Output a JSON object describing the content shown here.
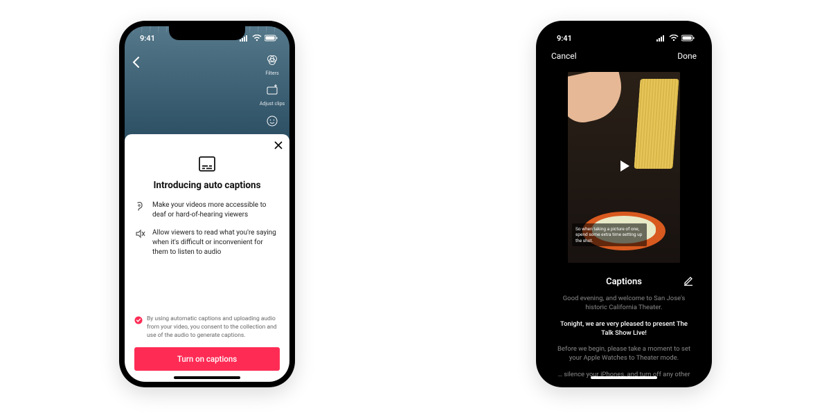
{
  "status": {
    "time": "9:41"
  },
  "left": {
    "tools": {
      "filters": "Filters",
      "adjust": "Adjust clips",
      "emoji": ""
    },
    "sheet": {
      "title": "Introducing auto captions",
      "benefit1": "Make your videos more accessible to deaf or hard-of-hearing viewers",
      "benefit2": "Allow viewers to read what you're saying when it's difficult or inconvenient for them to listen to audio",
      "consent": "By using automatic captions and uploading audio from your video, you consent to the collection and use of the audio to generate captions.",
      "cta": "Turn on captions"
    }
  },
  "right": {
    "cancel": "Cancel",
    "done": "Done",
    "overlay_caption": "So when taking a picture of one, spend some extra time setting up the shot.",
    "captions_title": "Captions",
    "lines": {
      "l1": "Good evening, and welcome to San Jose's historic California Theater.",
      "l2": "Tonight, we are very pleased to present The Talk Show Live!",
      "l3": "Before we begin, please take a moment to set your Apple Watches to Theater mode.",
      "l4": "… silence your iPhones, and turn off any other"
    }
  }
}
